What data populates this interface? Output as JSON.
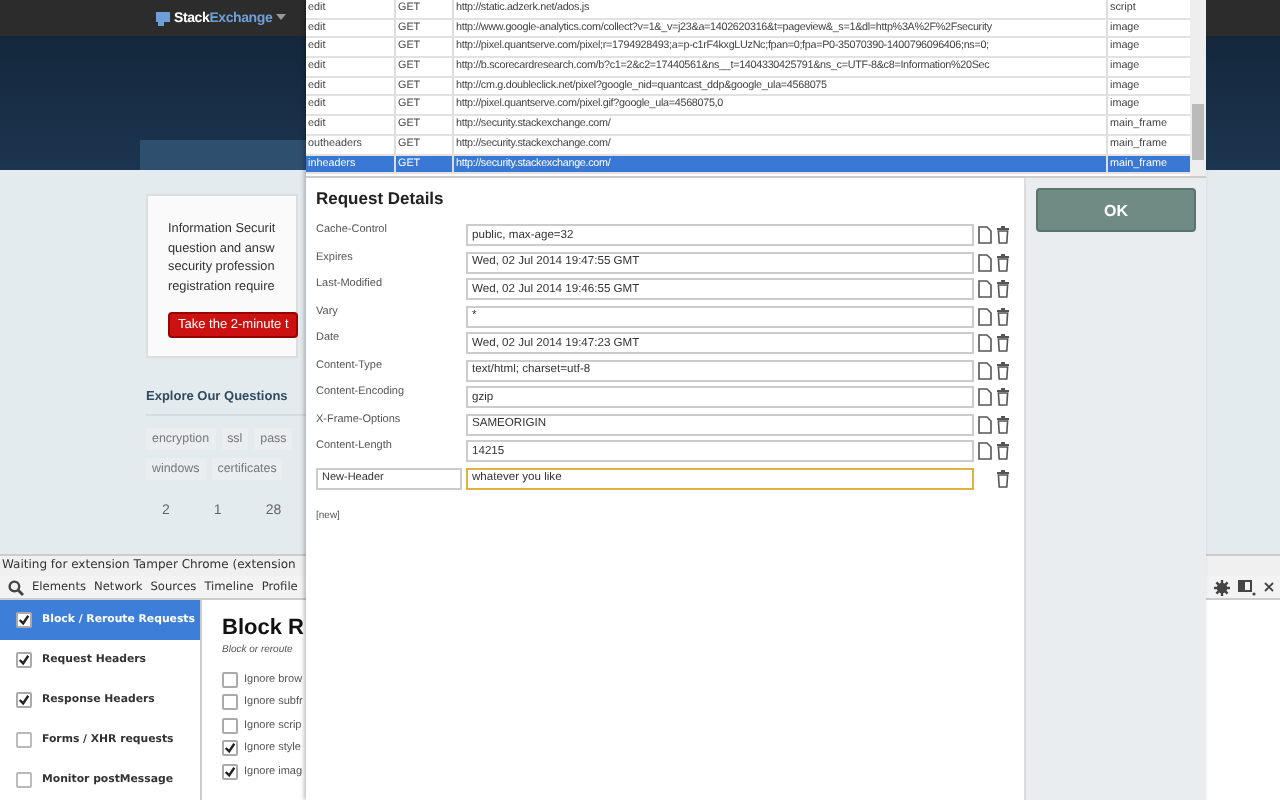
{
  "page": {
    "logo": {
      "brand": "Stack",
      "accent": "Exchange"
    },
    "intro": "Information Securit\nquestion and answ\nsecurity profession\nregistration require",
    "cta": "Take the 2-minute t",
    "explore_heading": "Explore Our Questions",
    "tags": [
      "encryption",
      "ssl",
      "pass",
      "windows",
      "certificates"
    ],
    "stats": [
      "2",
      "1",
      "28"
    ]
  },
  "devtools": {
    "status": "Waiting for extension Tamper Chrome (extension",
    "tabs": [
      "Elements",
      "Network",
      "Sources",
      "Timeline",
      "Profile"
    ],
    "sidebar": [
      {
        "label": "Block / Reroute Requests",
        "checked": true,
        "selected": true
      },
      {
        "label": "Request Headers",
        "checked": true,
        "selected": false
      },
      {
        "label": "Response Headers",
        "checked": true,
        "selected": false
      },
      {
        "label": "Forms / XHR requests",
        "checked": false,
        "selected": false
      },
      {
        "label": "Monitor postMessage",
        "checked": false,
        "selected": false
      }
    ],
    "panel": {
      "title": "Block R",
      "subtitle": "Block or reroute",
      "options": [
        {
          "label": "Ignore brow",
          "checked": false
        },
        {
          "label": "Ignore subfr",
          "checked": false
        },
        {
          "label": "Ignore scrip",
          "checked": false
        },
        {
          "label": "Ignore style",
          "checked": true
        },
        {
          "label": "Ignore imag",
          "checked": true
        }
      ]
    }
  },
  "dialog": {
    "requests": [
      {
        "action": "edit",
        "method": "GET",
        "url": "http://static.adzerk.net/ados.js",
        "type": "script",
        "selected": false
      },
      {
        "action": "edit",
        "method": "GET",
        "url": "http://www.google-analytics.com/collect?v=1&_v=j23&a=1402620316&t=pageview&_s=1&dl=http%3A%2F%2Fsecurity",
        "type": "image",
        "selected": false
      },
      {
        "action": "edit",
        "method": "GET",
        "url": "http://pixel.quantserve.com/pixel;r=1794928493;a=p-c1rF4kxgLUzNc;fpan=0;fpa=P0-35070390-1400796096406;ns=0;",
        "type": "image",
        "selected": false
      },
      {
        "action": "edit",
        "method": "GET",
        "url": "http://b.scorecardresearch.com/b?c1=2&c2=17440561&ns__t=1404330425791&ns_c=UTF-8&c8=Information%20Sec",
        "type": "image",
        "selected": false
      },
      {
        "action": "edit",
        "method": "GET",
        "url": "http://cm.g.doubleclick.net/pixel?google_nid=quantcast_ddp&google_ula=4568075",
        "type": "image",
        "selected": false
      },
      {
        "action": "edit",
        "method": "GET",
        "url": "http://pixel.quantserve.com/pixel.gif?google_ula=4568075,0",
        "type": "image",
        "selected": false
      },
      {
        "action": "edit",
        "method": "GET",
        "url": "http://security.stackexchange.com/",
        "type": "main_frame",
        "selected": false
      },
      {
        "action": "outheaders",
        "method": "GET",
        "url": "http://security.stackexchange.com/",
        "type": "main_frame",
        "selected": false
      },
      {
        "action": "inheaders",
        "method": "GET",
        "url": "http://security.stackexchange.com/",
        "type": "main_frame",
        "selected": true
      }
    ],
    "title": "Request Details",
    "headers": [
      {
        "kind": "header",
        "name": "Cache-Control",
        "value": "public, max-age=32"
      },
      {
        "kind": "header",
        "name": "Expires",
        "value": "Wed, 02 Jul 2014 19:47:55 GMT"
      },
      {
        "kind": "header",
        "name": "Last-Modified",
        "value": "Wed, 02 Jul 2014 19:46:55 GMT"
      },
      {
        "kind": "header",
        "name": "Vary",
        "value": "*"
      },
      {
        "kind": "header",
        "name": "Date",
        "value": "Wed, 02 Jul 2014 19:47:23 GMT"
      },
      {
        "kind": "header",
        "name": "Content-Type",
        "value": "text/html; charset=utf-8"
      },
      {
        "kind": "header",
        "name": "Content-Encoding",
        "value": "gzip"
      },
      {
        "kind": "header",
        "name": "X-Frame-Options",
        "value": "SAMEORIGIN"
      },
      {
        "kind": "header",
        "name": "Content-Length",
        "value": "14215"
      },
      {
        "kind": "new",
        "name": "New-Header",
        "value": "whatever you like",
        "focused": true
      }
    ],
    "new_link": "[new]",
    "ok": "OK"
  }
}
